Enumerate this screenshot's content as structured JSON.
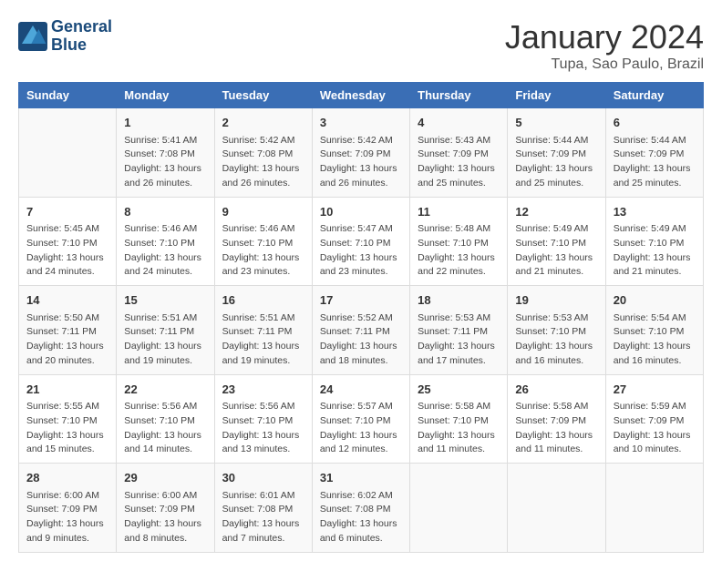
{
  "header": {
    "logo_line1": "General",
    "logo_line2": "Blue",
    "month": "January 2024",
    "location": "Tupa, Sao Paulo, Brazil"
  },
  "days_of_week": [
    "Sunday",
    "Monday",
    "Tuesday",
    "Wednesday",
    "Thursday",
    "Friday",
    "Saturday"
  ],
  "weeks": [
    [
      {
        "day": "",
        "info": ""
      },
      {
        "day": "1",
        "info": "Sunrise: 5:41 AM\nSunset: 7:08 PM\nDaylight: 13 hours\nand 26 minutes."
      },
      {
        "day": "2",
        "info": "Sunrise: 5:42 AM\nSunset: 7:08 PM\nDaylight: 13 hours\nand 26 minutes."
      },
      {
        "day": "3",
        "info": "Sunrise: 5:42 AM\nSunset: 7:09 PM\nDaylight: 13 hours\nand 26 minutes."
      },
      {
        "day": "4",
        "info": "Sunrise: 5:43 AM\nSunset: 7:09 PM\nDaylight: 13 hours\nand 25 minutes."
      },
      {
        "day": "5",
        "info": "Sunrise: 5:44 AM\nSunset: 7:09 PM\nDaylight: 13 hours\nand 25 minutes."
      },
      {
        "day": "6",
        "info": "Sunrise: 5:44 AM\nSunset: 7:09 PM\nDaylight: 13 hours\nand 25 minutes."
      }
    ],
    [
      {
        "day": "7",
        "info": "Sunrise: 5:45 AM\nSunset: 7:10 PM\nDaylight: 13 hours\nand 24 minutes."
      },
      {
        "day": "8",
        "info": "Sunrise: 5:46 AM\nSunset: 7:10 PM\nDaylight: 13 hours\nand 24 minutes."
      },
      {
        "day": "9",
        "info": "Sunrise: 5:46 AM\nSunset: 7:10 PM\nDaylight: 13 hours\nand 23 minutes."
      },
      {
        "day": "10",
        "info": "Sunrise: 5:47 AM\nSunset: 7:10 PM\nDaylight: 13 hours\nand 23 minutes."
      },
      {
        "day": "11",
        "info": "Sunrise: 5:48 AM\nSunset: 7:10 PM\nDaylight: 13 hours\nand 22 minutes."
      },
      {
        "day": "12",
        "info": "Sunrise: 5:49 AM\nSunset: 7:10 PM\nDaylight: 13 hours\nand 21 minutes."
      },
      {
        "day": "13",
        "info": "Sunrise: 5:49 AM\nSunset: 7:10 PM\nDaylight: 13 hours\nand 21 minutes."
      }
    ],
    [
      {
        "day": "14",
        "info": "Sunrise: 5:50 AM\nSunset: 7:11 PM\nDaylight: 13 hours\nand 20 minutes."
      },
      {
        "day": "15",
        "info": "Sunrise: 5:51 AM\nSunset: 7:11 PM\nDaylight: 13 hours\nand 19 minutes."
      },
      {
        "day": "16",
        "info": "Sunrise: 5:51 AM\nSunset: 7:11 PM\nDaylight: 13 hours\nand 19 minutes."
      },
      {
        "day": "17",
        "info": "Sunrise: 5:52 AM\nSunset: 7:11 PM\nDaylight: 13 hours\nand 18 minutes."
      },
      {
        "day": "18",
        "info": "Sunrise: 5:53 AM\nSunset: 7:11 PM\nDaylight: 13 hours\nand 17 minutes."
      },
      {
        "day": "19",
        "info": "Sunrise: 5:53 AM\nSunset: 7:10 PM\nDaylight: 13 hours\nand 16 minutes."
      },
      {
        "day": "20",
        "info": "Sunrise: 5:54 AM\nSunset: 7:10 PM\nDaylight: 13 hours\nand 16 minutes."
      }
    ],
    [
      {
        "day": "21",
        "info": "Sunrise: 5:55 AM\nSunset: 7:10 PM\nDaylight: 13 hours\nand 15 minutes."
      },
      {
        "day": "22",
        "info": "Sunrise: 5:56 AM\nSunset: 7:10 PM\nDaylight: 13 hours\nand 14 minutes."
      },
      {
        "day": "23",
        "info": "Sunrise: 5:56 AM\nSunset: 7:10 PM\nDaylight: 13 hours\nand 13 minutes."
      },
      {
        "day": "24",
        "info": "Sunrise: 5:57 AM\nSunset: 7:10 PM\nDaylight: 13 hours\nand 12 minutes."
      },
      {
        "day": "25",
        "info": "Sunrise: 5:58 AM\nSunset: 7:10 PM\nDaylight: 13 hours\nand 11 minutes."
      },
      {
        "day": "26",
        "info": "Sunrise: 5:58 AM\nSunset: 7:09 PM\nDaylight: 13 hours\nand 11 minutes."
      },
      {
        "day": "27",
        "info": "Sunrise: 5:59 AM\nSunset: 7:09 PM\nDaylight: 13 hours\nand 10 minutes."
      }
    ],
    [
      {
        "day": "28",
        "info": "Sunrise: 6:00 AM\nSunset: 7:09 PM\nDaylight: 13 hours\nand 9 minutes."
      },
      {
        "day": "29",
        "info": "Sunrise: 6:00 AM\nSunset: 7:09 PM\nDaylight: 13 hours\nand 8 minutes."
      },
      {
        "day": "30",
        "info": "Sunrise: 6:01 AM\nSunset: 7:08 PM\nDaylight: 13 hours\nand 7 minutes."
      },
      {
        "day": "31",
        "info": "Sunrise: 6:02 AM\nSunset: 7:08 PM\nDaylight: 13 hours\nand 6 minutes."
      },
      {
        "day": "",
        "info": ""
      },
      {
        "day": "",
        "info": ""
      },
      {
        "day": "",
        "info": ""
      }
    ]
  ]
}
